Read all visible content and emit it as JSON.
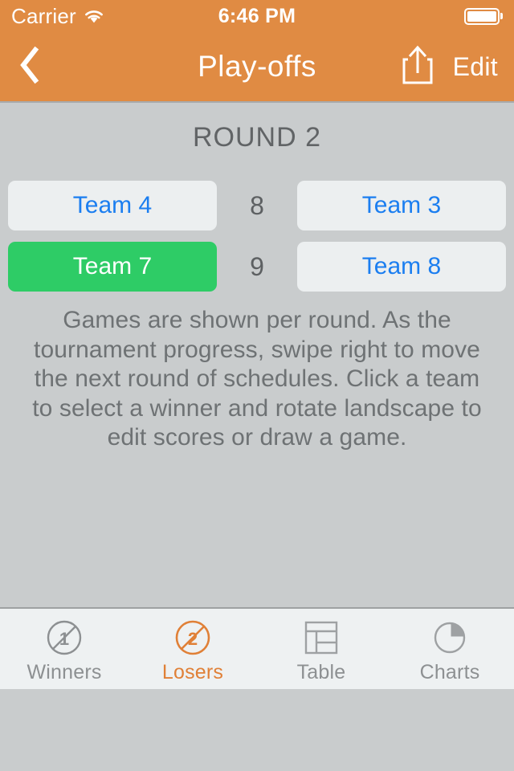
{
  "status_bar": {
    "carrier": "Carrier",
    "wifi_icon": "wifi-icon",
    "time": "6:46 PM",
    "battery_icon": "battery-full-icon"
  },
  "nav_bar": {
    "back_icon": "chevron-left-icon",
    "title": "Play-offs",
    "share_icon": "share-icon",
    "edit_label": "Edit"
  },
  "main": {
    "round_title": "ROUND 2",
    "matches": [
      {
        "home": "Team 4",
        "home_winner": false,
        "score": "8",
        "away": "Team 3",
        "away_winner": false
      },
      {
        "home": "Team 7",
        "home_winner": true,
        "score": "9",
        "away": "Team 8",
        "away_winner": false
      }
    ],
    "description": "Games are shown per round. As the tournament progress, swipe right to move the next round of schedules. Click a team to select a winner and rotate landscape to edit scores or draw a game.",
    "page_dots": {
      "count": 4,
      "active_index": 0
    }
  },
  "tab_bar": {
    "tabs": [
      {
        "label": "Winners",
        "icon": "no-one-icon",
        "active": false
      },
      {
        "label": "Losers",
        "icon": "no-two-icon",
        "active": true
      },
      {
        "label": "Table",
        "icon": "table-icon",
        "active": false
      },
      {
        "label": "Charts",
        "icon": "pie-chart-icon",
        "active": false
      }
    ]
  },
  "colors": {
    "brand_orange": "#e08b43",
    "accent_orange": "#e08037",
    "winner_green": "#2ecc66",
    "team_blue": "#1b7ef0",
    "background_gray": "#c9cccd"
  }
}
